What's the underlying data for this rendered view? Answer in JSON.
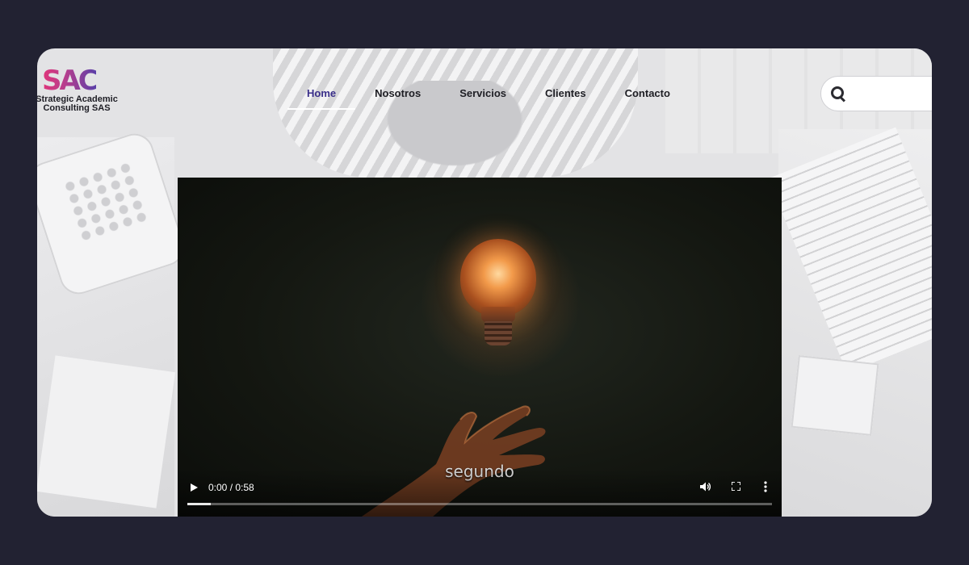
{
  "brand": {
    "mark": "SAC",
    "name_line1": "Strategic Academic",
    "name_line2": "Consulting SAS"
  },
  "nav": {
    "items": [
      {
        "label": "Home",
        "active": true
      },
      {
        "label": "Nosotros",
        "active": false
      },
      {
        "label": "Servicios",
        "active": false
      },
      {
        "label": "Clientes",
        "active": false
      },
      {
        "label": "Contacto",
        "active": false
      }
    ]
  },
  "search": {
    "placeholder": "",
    "icon": "search-icon"
  },
  "video": {
    "caption": "segundo",
    "time": "0:00 / 0:58",
    "progress": 0.04,
    "controls": [
      "play-icon",
      "volume-icon",
      "fullscreen-icon",
      "more-options-icon"
    ]
  },
  "colors": {
    "page_bg": "#222232",
    "active_nav": "#3a2f8a",
    "logo_gradient": [
      "#e0357a",
      "#5a3fa8"
    ]
  }
}
